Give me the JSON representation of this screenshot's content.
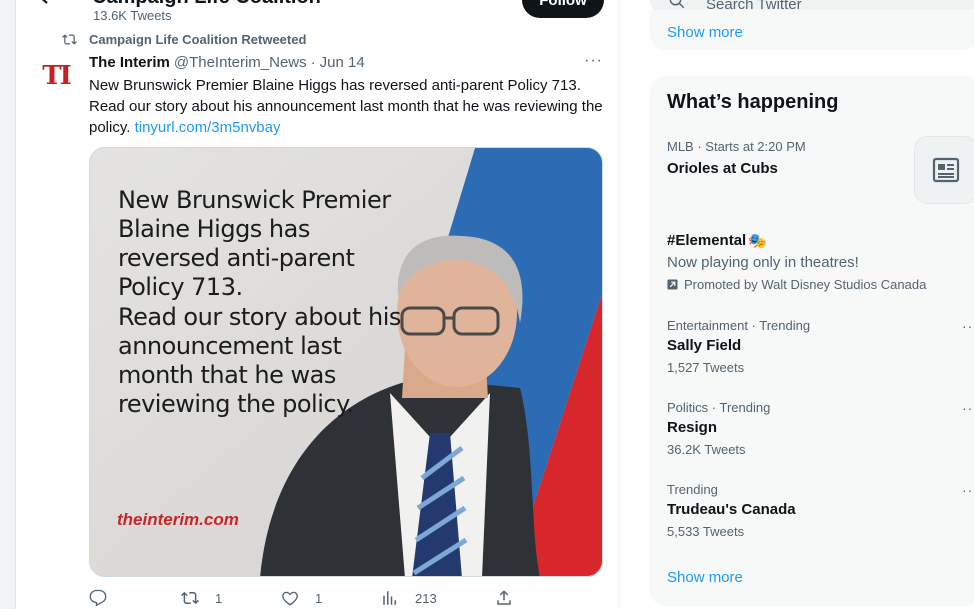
{
  "profile": {
    "name": "Campaign Life Coalition",
    "tweet_count": "13.6K Tweets",
    "follow_label": "Follow"
  },
  "retweet": {
    "label": "Campaign Life Coalition Retweeted"
  },
  "tweet": {
    "avatar_text": "TI",
    "author": "The Interim",
    "handle": "@TheInterim_News",
    "separator": "·",
    "date": "Jun 14",
    "more": "···",
    "text": "New Brunswick Premier Blaine Higgs has reversed anti-parent Policy 713. Read our story about his announcement last month that he was reviewing the policy.",
    "link": "tinyurl.com/3m5nvbay",
    "media": {
      "headline_1": "New Brunswick Premier Blaine Higgs has reversed anti-parent Policy 713.",
      "headline_2": "Read our story about his announcement last month that he was reviewing the policy.",
      "site": "theinterim.com"
    },
    "actions": {
      "reply_count": "",
      "retweet_count": "1",
      "like_count": "1",
      "view_count": "213"
    }
  },
  "sidebar": {
    "search_placeholder": "Search Twitter",
    "show_more_top": "Show more",
    "trends_title": "What’s happening",
    "trends": [
      {
        "context": "MLB · Starts at 2:20 PM",
        "name": "Orioles at Cubs"
      },
      {
        "name": "#Elemental",
        "emoji": "🎭",
        "description": "Now playing only in theatres!",
        "promoted": "Promoted by Walt Disney Studios Canada"
      },
      {
        "context": "Entertainment · Trending",
        "name": "Sally Field",
        "count": "1,527 Tweets"
      },
      {
        "context": "Politics · Trending",
        "name": "Resign",
        "count": "36.2K Tweets"
      },
      {
        "context": "Trending",
        "name": "Trudeau's Canada",
        "count": "5,533 Tweets"
      }
    ],
    "show_more_bottom": "Show more"
  }
}
